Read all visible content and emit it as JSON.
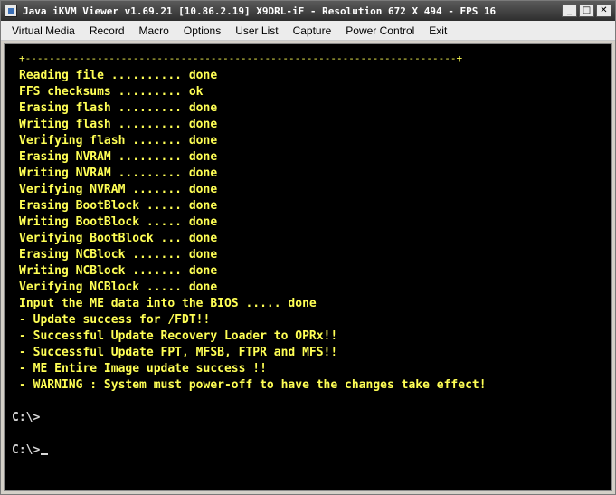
{
  "window": {
    "title": "Java iKVM Viewer v1.69.21 [10.86.2.19] X9DRL-iF - Resolution 672 X 494 - FPS 16",
    "buttons": {
      "minimize": "_",
      "maximize": "□",
      "close": "✕"
    }
  },
  "menu": {
    "items": [
      "Virtual Media",
      "Record",
      "Macro",
      "Options",
      "User List",
      "Capture",
      "Power Control",
      "Exit"
    ]
  },
  "console": {
    "border": "+------------------------------------------------------------------------+",
    "lines": [
      "Reading file .......... done",
      "FFS checksums ......... ok",
      "Erasing flash ......... done",
      "Writing flash ......... done",
      "Verifying flash ....... done",
      "Erasing NVRAM ......... done",
      "Writing NVRAM ......... done",
      "Verifying NVRAM ....... done",
      "Erasing BootBlock ..... done",
      "Writing BootBlock ..... done",
      "Verifying BootBlock ... done",
      "Erasing NCBlock ....... done",
      "Writing NCBlock ....... done",
      "Verifying NCBlock ..... done",
      "Input the ME data into the BIOS ..... done",
      "- Update success for /FDT!!",
      "- Successful Update Recovery Loader to OPRx!!",
      "- Successful Update FPT, MFSB, FTPR and MFS!!",
      "- ME Entire Image update success !!",
      "- WARNING : System must power-off to have the changes take effect!"
    ],
    "prompts": [
      "C:\\>",
      "C:\\>"
    ]
  },
  "colors": {
    "console_bg": "#000000",
    "console_text": "#ffff55",
    "prompt_text": "#d8d8d8",
    "titlebar": "#3a3a3a",
    "menubar": "#ececec"
  }
}
